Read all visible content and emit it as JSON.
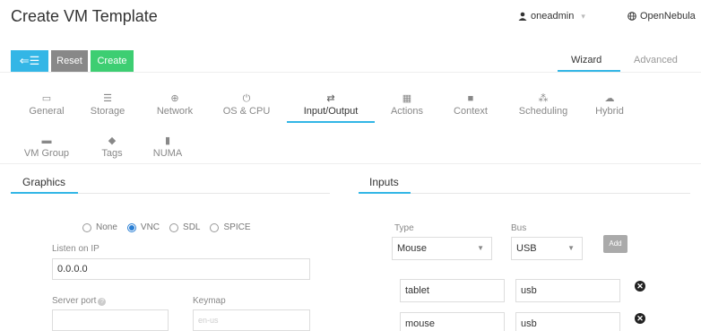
{
  "header": {
    "title": "Create VM Template",
    "user": "oneadmin",
    "zone": "OpenNebula"
  },
  "toolbar": {
    "back_label": "⇐☰",
    "reset_label": "Reset",
    "create_label": "Create"
  },
  "modes": {
    "wizard": "Wizard",
    "advanced": "Advanced",
    "active": "Wizard"
  },
  "tabs": [
    {
      "label": "General",
      "icon": "laptop-icon",
      "glyph": "▭"
    },
    {
      "label": "Storage",
      "icon": "storage-icon",
      "glyph": "☰"
    },
    {
      "label": "Network",
      "icon": "globe-icon",
      "glyph": "⊕"
    },
    {
      "label": "OS & CPU",
      "icon": "power-icon",
      "glyph": "⏻"
    },
    {
      "label": "Input/Output",
      "icon": "exchange-icon",
      "glyph": "⇄"
    },
    {
      "label": "Actions",
      "icon": "calendar-icon",
      "glyph": "▦"
    },
    {
      "label": "Context",
      "icon": "folder-icon",
      "glyph": "■"
    },
    {
      "label": "Scheduling",
      "icon": "sitemap-icon",
      "glyph": "⁂"
    },
    {
      "label": "Hybrid",
      "icon": "cloud-icon",
      "glyph": "☁"
    },
    {
      "label": "VM Group",
      "icon": "folder-open-icon",
      "glyph": "▬"
    },
    {
      "label": "Tags",
      "icon": "tag-icon",
      "glyph": "◆"
    },
    {
      "label": "NUMA",
      "icon": "chip-icon",
      "glyph": "▮"
    }
  ],
  "active_tab": "Input/Output",
  "graphics": {
    "section_title": "Graphics",
    "options": [
      "None",
      "VNC",
      "SDL",
      "SPICE"
    ],
    "selected": "VNC",
    "listen_label": "Listen on IP",
    "listen_value": "0.0.0.0",
    "port_label": "Server port",
    "port_value": "",
    "keymap_label": "Keymap",
    "keymap_placeholder": "en-us"
  },
  "inputs": {
    "section_title": "Inputs",
    "type_label": "Type",
    "bus_label": "Bus",
    "type_value": "Mouse",
    "bus_value": "USB",
    "add_label": "Add",
    "rows": [
      {
        "type": "tablet",
        "bus": "usb"
      },
      {
        "type": "mouse",
        "bus": "usb"
      }
    ]
  },
  "colors": {
    "accent": "#33b6e6",
    "reset": "#888888",
    "create": "#3dce72"
  }
}
